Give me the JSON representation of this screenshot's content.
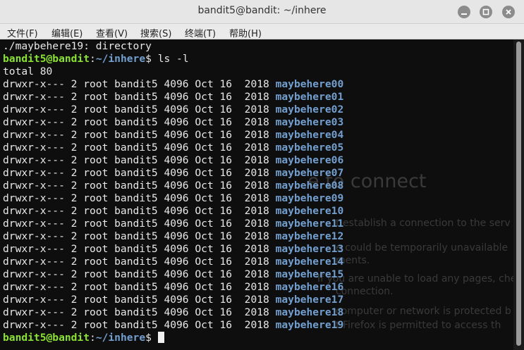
{
  "window": {
    "title": "bandit5@bandit: ~/inhere"
  },
  "menu": {
    "items": [
      "文件(F)",
      "编辑(E)",
      "查看(V)",
      "搜索(S)",
      "终端(T)",
      "帮助(H)"
    ]
  },
  "colors": {
    "prompt_user": "#8ae234",
    "prompt_path": "#729fcf",
    "directory": "#729fcf",
    "terminal_bg": "#0e0e0e"
  },
  "background_page": {
    "heading": "e to connect",
    "lines": [
      "t establish a connection to the serv",
      "e could be temporarily unavailable",
      "ments.",
      "If you are unable to load any pages, check",
      "connection.",
      "computer or network is protected b",
      "t Firefox is permitted to access th"
    ]
  },
  "terminal": {
    "first_line": "./maybehere19: directory",
    "prompt_user": "bandit5@bandit",
    "prompt_sep": ":",
    "prompt_path": "~/inhere",
    "prompt_end": "$ ",
    "command": "ls -l",
    "total": "total 80",
    "entries": [
      {
        "perm": "drwxr-x--- 2 root bandit5 4096 Oct 16  2018 ",
        "name": "maybehere00"
      },
      {
        "perm": "drwxr-x--- 2 root bandit5 4096 Oct 16  2018 ",
        "name": "maybehere01"
      },
      {
        "perm": "drwxr-x--- 2 root bandit5 4096 Oct 16  2018 ",
        "name": "maybehere02"
      },
      {
        "perm": "drwxr-x--- 2 root bandit5 4096 Oct 16  2018 ",
        "name": "maybehere03"
      },
      {
        "perm": "drwxr-x--- 2 root bandit5 4096 Oct 16  2018 ",
        "name": "maybehere04"
      },
      {
        "perm": "drwxr-x--- 2 root bandit5 4096 Oct 16  2018 ",
        "name": "maybehere05"
      },
      {
        "perm": "drwxr-x--- 2 root bandit5 4096 Oct 16  2018 ",
        "name": "maybehere06"
      },
      {
        "perm": "drwxr-x--- 2 root bandit5 4096 Oct 16  2018 ",
        "name": "maybehere07"
      },
      {
        "perm": "drwxr-x--- 2 root bandit5 4096 Oct 16  2018 ",
        "name": "maybehere08"
      },
      {
        "perm": "drwxr-x--- 2 root bandit5 4096 Oct 16  2018 ",
        "name": "maybehere09"
      },
      {
        "perm": "drwxr-x--- 2 root bandit5 4096 Oct 16  2018 ",
        "name": "maybehere10"
      },
      {
        "perm": "drwxr-x--- 2 root bandit5 4096 Oct 16  2018 ",
        "name": "maybehere11"
      },
      {
        "perm": "drwxr-x--- 2 root bandit5 4096 Oct 16  2018 ",
        "name": "maybehere12"
      },
      {
        "perm": "drwxr-x--- 2 root bandit5 4096 Oct 16  2018 ",
        "name": "maybehere13"
      },
      {
        "perm": "drwxr-x--- 2 root bandit5 4096 Oct 16  2018 ",
        "name": "maybehere14"
      },
      {
        "perm": "drwxr-x--- 2 root bandit5 4096 Oct 16  2018 ",
        "name": "maybehere15"
      },
      {
        "perm": "drwxr-x--- 2 root bandit5 4096 Oct 16  2018 ",
        "name": "maybehere16"
      },
      {
        "perm": "drwxr-x--- 2 root bandit5 4096 Oct 16  2018 ",
        "name": "maybehere17"
      },
      {
        "perm": "drwxr-x--- 2 root bandit5 4096 Oct 16  2018 ",
        "name": "maybehere18"
      },
      {
        "perm": "drwxr-x--- 2 root bandit5 4096 Oct 16  2018 ",
        "name": "maybehere19"
      }
    ]
  }
}
